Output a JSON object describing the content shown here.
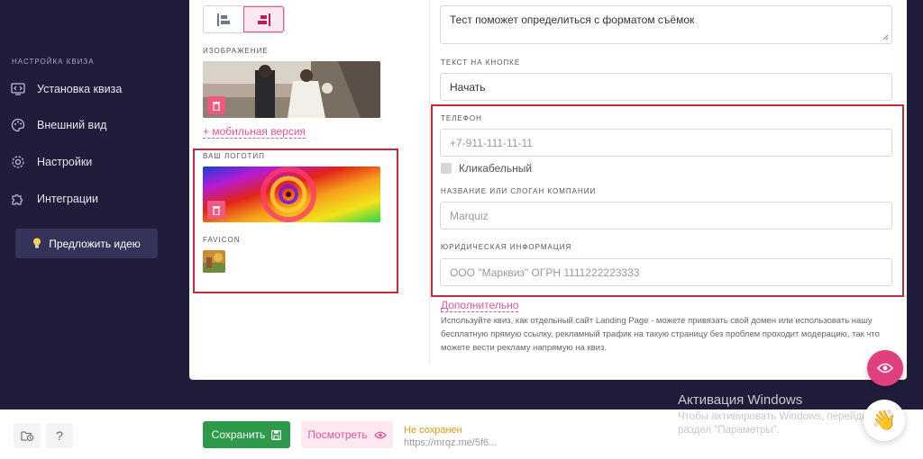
{
  "sidebar": {
    "heading": "НАСТРОЙКА КВИЗА",
    "items": [
      {
        "label": "Установка квиза",
        "icon": "monitor-code-icon"
      },
      {
        "label": "Внешний вид",
        "icon": "palette-icon"
      },
      {
        "label": "Настройки",
        "icon": "gear-icon"
      },
      {
        "label": "Интеграции",
        "icon": "puzzle-icon"
      }
    ],
    "suggest_label": "Предложить идею"
  },
  "left_column": {
    "image_label": "ИЗОБРАЖЕНИЕ",
    "mobile_link": "+ мобильная версия",
    "logo_label": "ВАШ ЛОГОТИП",
    "favicon_label": "FAVICON"
  },
  "right_column": {
    "description_value": "Тест поможет определиться с форматом съёмок",
    "button_text_label": "ТЕКСТ НА КНОПКЕ",
    "button_text_value": "Начать",
    "phone_label": "ТЕЛЕФОН",
    "phone_placeholder": "+7-911-111-11-11",
    "clickable_label": "Кликабельный",
    "company_label": "НАЗВАНИЕ ИЛИ СЛОГАН КОМПАНИИ",
    "company_placeholder": "Marquiz",
    "legal_label": "ЮРИДИЧЕСКАЯ ИНФОРМАЦИЯ",
    "legal_placeholder": "ООО \"Марквиз\" ОГРН 1111222223333",
    "more_link": "Дополнительно",
    "help_text": "Используйте квиз, как отдельный сайт Landing Page - можете привязать свой домен или использовать нашу бесплатную прямую ссылку, рекламный трафик на такую страницу без проблем проходит модерацию, так что можете вести рекламу напрямую на квиз."
  },
  "bottom_bar": {
    "save_label": "Сохранить",
    "view_label": "Посмотреть",
    "status": "Не сохранен",
    "url": "https://mrqz.me/5f6...",
    "help_glyph": "?"
  },
  "watermark": {
    "title": "Активация Windows",
    "line1": "Чтобы активировать Windows, перейдите в",
    "line2": "раздел \"Параметры\"."
  },
  "colors": {
    "sidebar_bg": "#1f1d3a",
    "accent_pink": "#e0569a",
    "save_green": "#2c9a4a",
    "highlight_red": "#c62a3a",
    "status_orange": "#e09a1a"
  }
}
